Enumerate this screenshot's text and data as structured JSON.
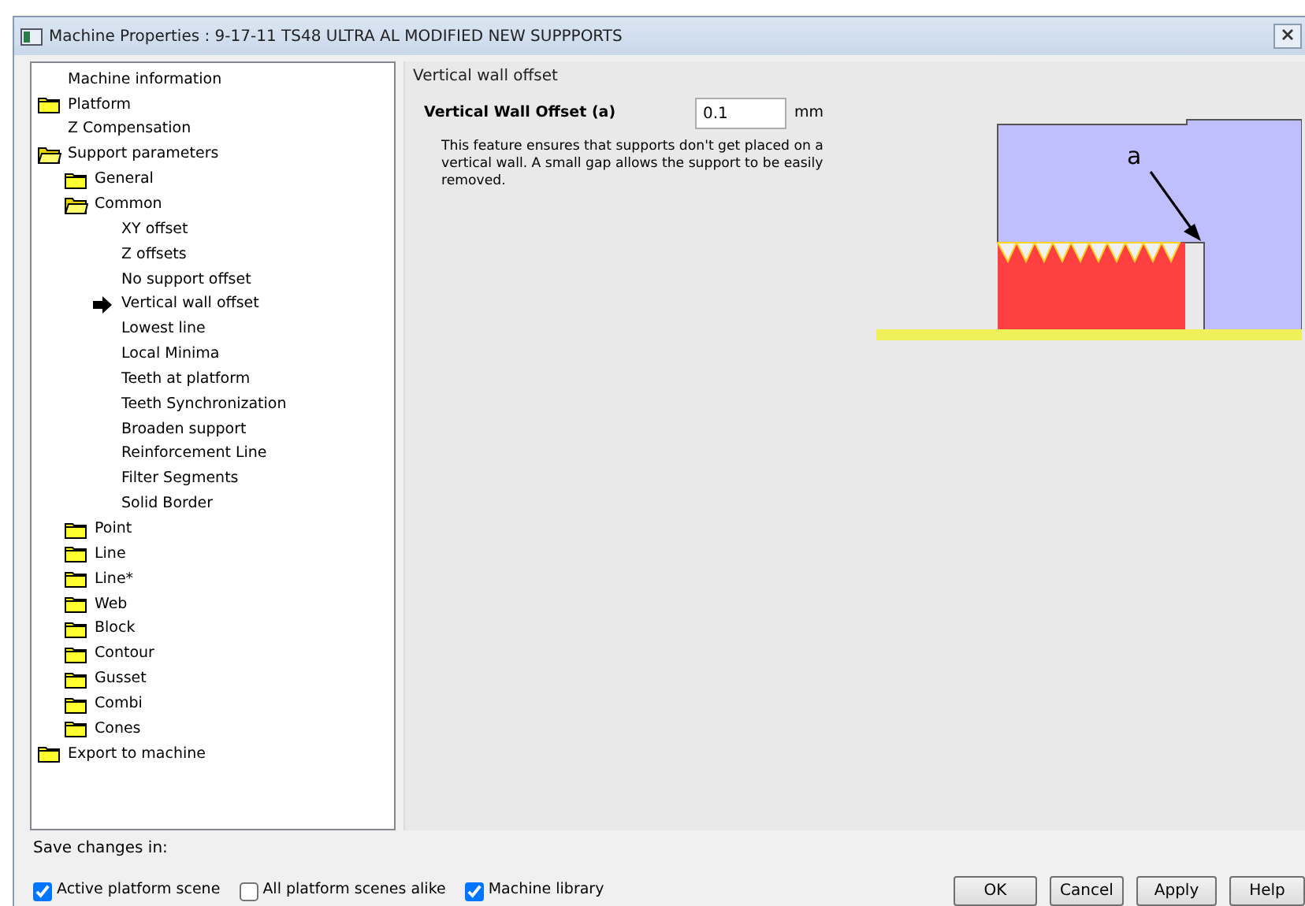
{
  "window": {
    "title": "Machine Properties : 9-17-11 TS48 ULTRA AL MODIFIED NEW SUPPPORTS"
  },
  "tree": [
    {
      "kind": "leaf",
      "label": "Machine information",
      "selected": false
    },
    {
      "kind": "folder",
      "label": "Platform",
      "expanded": false,
      "selected": false
    },
    {
      "kind": "leaf",
      "label": "Z Compensation",
      "selected": false
    },
    {
      "kind": "folder",
      "label": "Support parameters",
      "expanded": true,
      "selected": false,
      "children": [
        {
          "kind": "folder",
          "label": "General",
          "expanded": false,
          "selected": false
        },
        {
          "kind": "folder",
          "label": "Common",
          "expanded": true,
          "selected": false,
          "children": [
            {
              "kind": "leaf",
              "label": "XY offset",
              "selected": false
            },
            {
              "kind": "leaf",
              "label": "Z offsets",
              "selected": false
            },
            {
              "kind": "leaf",
              "label": "No support offset",
              "selected": false
            },
            {
              "kind": "leaf",
              "label": "Vertical wall offset",
              "selected": true
            },
            {
              "kind": "leaf",
              "label": "Lowest line",
              "selected": false
            },
            {
              "kind": "leaf",
              "label": "Local Minima",
              "selected": false
            },
            {
              "kind": "leaf",
              "label": "Teeth at platform",
              "selected": false
            },
            {
              "kind": "leaf",
              "label": "Teeth Synchronization",
              "selected": false
            },
            {
              "kind": "leaf",
              "label": "Broaden support",
              "selected": false
            },
            {
              "kind": "leaf",
              "label": "Reinforcement Line",
              "selected": false
            },
            {
              "kind": "leaf",
              "label": "Filter Segments",
              "selected": false
            },
            {
              "kind": "leaf",
              "label": "Solid Border",
              "selected": false
            }
          ]
        },
        {
          "kind": "folder",
          "label": "Point",
          "expanded": false,
          "selected": false
        },
        {
          "kind": "folder",
          "label": "Line",
          "expanded": false,
          "selected": false
        },
        {
          "kind": "folder",
          "label": "Line*",
          "expanded": false,
          "selected": false
        },
        {
          "kind": "folder",
          "label": "Web",
          "expanded": false,
          "selected": false
        },
        {
          "kind": "folder",
          "label": "Block",
          "expanded": false,
          "selected": false
        },
        {
          "kind": "folder",
          "label": "Contour",
          "expanded": false,
          "selected": false
        },
        {
          "kind": "folder",
          "label": "Gusset",
          "expanded": false,
          "selected": false
        },
        {
          "kind": "folder",
          "label": "Combi",
          "expanded": false,
          "selected": false
        },
        {
          "kind": "folder",
          "label": "Cones",
          "expanded": false,
          "selected": false
        }
      ]
    },
    {
      "kind": "folder",
      "label": "Export to machine",
      "expanded": false,
      "selected": false
    }
  ],
  "panel": {
    "group_title": "Vertical wall offset",
    "field_label": "Vertical Wall Offset (a)",
    "field_value": "0.1",
    "unit": "mm",
    "description": "This feature ensures that supports don't get placed on a vertical wall. A small gap allows the support to be easily removed.",
    "diagram_label": "a"
  },
  "save": {
    "label": "Save changes in:",
    "options": [
      {
        "label": "Active platform scene",
        "checked": true
      },
      {
        "label": "All platform scenes alike",
        "checked": false
      },
      {
        "label": "Machine library",
        "checked": true
      }
    ]
  },
  "buttons": [
    "OK",
    "Cancel",
    "Apply",
    "Help"
  ]
}
